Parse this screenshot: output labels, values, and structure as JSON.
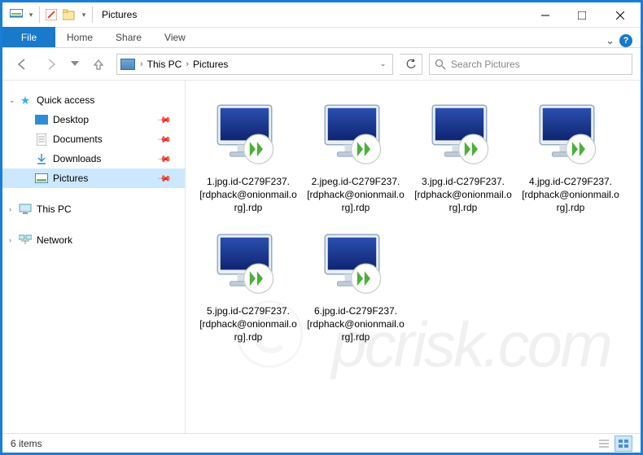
{
  "window": {
    "title": "Pictures"
  },
  "ribbon": {
    "file": "File",
    "tabs": [
      "Home",
      "Share",
      "View"
    ]
  },
  "breadcrumb": {
    "segments": [
      "This PC",
      "Pictures"
    ]
  },
  "search": {
    "placeholder": "Search Pictures",
    "icon": "search-icon"
  },
  "sidebar": {
    "quick_access": {
      "label": "Quick access",
      "icon": "star-icon"
    },
    "items": [
      {
        "label": "Desktop",
        "icon": "desktop-icon",
        "pinned": true
      },
      {
        "label": "Documents",
        "icon": "documents-icon",
        "pinned": true
      },
      {
        "label": "Downloads",
        "icon": "downloads-icon",
        "pinned": true
      },
      {
        "label": "Pictures",
        "icon": "pictures-icon",
        "pinned": true,
        "selected": true
      }
    ],
    "this_pc": {
      "label": "This PC",
      "icon": "this-pc-icon"
    },
    "network": {
      "label": "Network",
      "icon": "network-icon"
    }
  },
  "files": [
    {
      "name": "1.jpg.id-C279F237.[rdphack@onionmail.org].rdp",
      "icon": "rdp-icon"
    },
    {
      "name": "2.jpeg.id-C279F237.[rdphack@onionmail.org].rdp",
      "icon": "rdp-icon"
    },
    {
      "name": "3.jpg.id-C279F237.[rdphack@onionmail.org].rdp",
      "icon": "rdp-icon"
    },
    {
      "name": "4.jpg.id-C279F237.[rdphack@onionmail.org].rdp",
      "icon": "rdp-icon"
    },
    {
      "name": "5.jpg.id-C279F237.[rdphack@onionmail.org].rdp",
      "icon": "rdp-icon"
    },
    {
      "name": "6.jpg.id-C279F237.[rdphack@onionmail.org].rdp",
      "icon": "rdp-icon"
    }
  ],
  "status": {
    "item_count": "6 items"
  },
  "watermark": "pcrisk.com"
}
